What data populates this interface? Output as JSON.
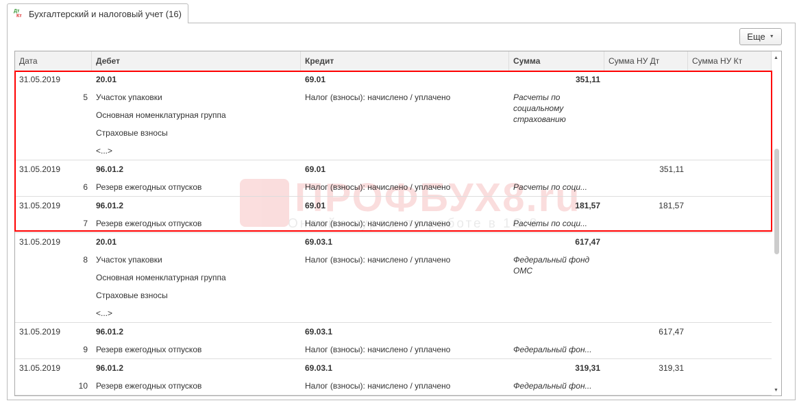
{
  "tab": {
    "icon_top": "Дт",
    "icon_bottom": "Кт",
    "label": "Бухгалтерский и налоговый учет (16)"
  },
  "toolbar": {
    "more_label": "Еще"
  },
  "columns": [
    "Дата",
    "Дебет",
    "Кредит",
    "Сумма",
    "Сумма НУ Дт",
    "Сумма НУ Кт"
  ],
  "watermark": {
    "logo": "ПРОФБУХ8.ru",
    "subtitle": "Онлайн-курсы по работе в 1С:8"
  },
  "rows": [
    {
      "date": "31.05.2019",
      "num": "5",
      "debit": "20.01",
      "credit": "69.01",
      "sum": "351,11",
      "nu_dt": "",
      "nu_kt": "",
      "debit_sub": [
        "Участок упаковки",
        "Основная номенклатурная группа",
        "Страховые взносы",
        "<...>"
      ],
      "credit_sub": "Налог (взносы): начислено / уплачено",
      "sum_sub": "Расчеты по социальному страхованию"
    },
    {
      "date": "31.05.2019",
      "num": "6",
      "debit": "96.01.2",
      "credit": "69.01",
      "sum": "",
      "nu_dt": "351,11",
      "nu_kt": "",
      "debit_sub": [
        "Резерв ежегодных отпусков"
      ],
      "credit_sub": "Налог (взносы): начислено / уплачено",
      "sum_sub": "Расчеты по соци..."
    },
    {
      "date": "31.05.2019",
      "num": "7",
      "debit": "96.01.2",
      "credit": "69.01",
      "sum": "181,57",
      "nu_dt": "181,57",
      "nu_kt": "",
      "debit_sub": [
        "Резерв ежегодных отпусков"
      ],
      "credit_sub": "Налог (взносы): начислено / уплачено",
      "sum_sub": "Расчеты по соци..."
    },
    {
      "date": "31.05.2019",
      "num": "8",
      "debit": "20.01",
      "credit": "69.03.1",
      "sum": "617,47",
      "nu_dt": "",
      "nu_kt": "",
      "debit_sub": [
        "Участок упаковки",
        "Основная номенклатурная группа",
        "Страховые взносы",
        "<...>"
      ],
      "credit_sub": "Налог (взносы): начислено / уплачено",
      "sum_sub": "Федеральный фонд ОМС"
    },
    {
      "date": "31.05.2019",
      "num": "9",
      "debit": "96.01.2",
      "credit": "69.03.1",
      "sum": "",
      "nu_dt": "617,47",
      "nu_kt": "",
      "debit_sub": [
        "Резерв ежегодных отпусков"
      ],
      "credit_sub": "Налог (взносы): начислено / уплачено",
      "sum_sub": "Федеральный фон..."
    },
    {
      "date": "31.05.2019",
      "num": "10",
      "debit": "96.01.2",
      "credit": "69.03.1",
      "sum": "319,31",
      "nu_dt": "319,31",
      "nu_kt": "",
      "debit_sub": [
        "Резерв ежегодных отпусков"
      ],
      "credit_sub": "Налог (взносы): начислено / уплачено",
      "sum_sub": "Федеральный фон..."
    }
  ]
}
